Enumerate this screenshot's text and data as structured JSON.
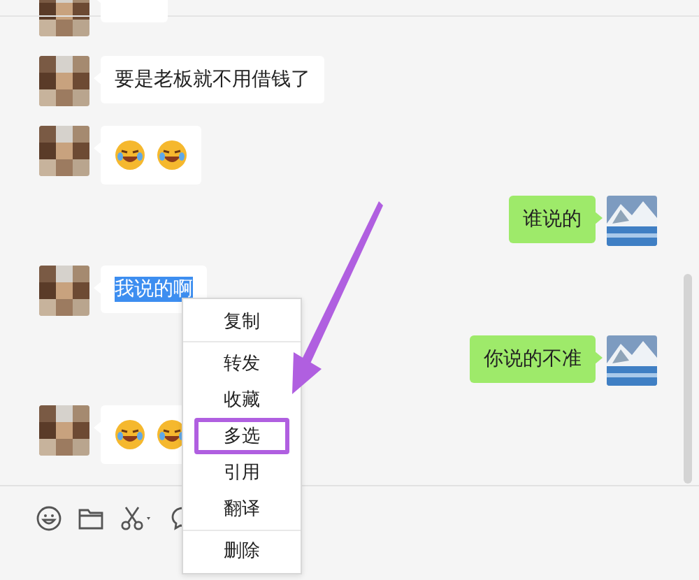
{
  "messages": [
    {
      "kind": "incoming_partial"
    },
    {
      "kind": "incoming_text",
      "text": "要是老板就不用借钱了"
    },
    {
      "kind": "incoming_emoji",
      "emojis": [
        {
          "kind": "laugh"
        },
        {
          "kind": "laugh"
        }
      ]
    },
    {
      "kind": "outgoing_text",
      "text": "谁说的"
    },
    {
      "kind": "incoming_text",
      "text": "我说的啊",
      "text_selected": true
    },
    {
      "kind": "outgoing_text",
      "text": "你说的不准"
    },
    {
      "kind": "incoming_emoji",
      "emojis": [
        {
          "kind": "laugh"
        },
        {
          "kind": "laugh"
        }
      ]
    }
  ],
  "context_menu": {
    "groups": [
      {
        "items": [
          {
            "label": "复制",
            "highlighted": false
          }
        ]
      },
      {
        "items": [
          {
            "label": "转发",
            "highlighted": false
          },
          {
            "label": "收藏",
            "highlighted": false
          },
          {
            "label": "多选",
            "highlighted": true
          },
          {
            "label": "引用",
            "highlighted": false
          },
          {
            "label": "翻译",
            "highlighted": false
          }
        ]
      },
      {
        "items": [
          {
            "label": "删除",
            "highlighted": false
          }
        ]
      }
    ]
  },
  "toolbar": [
    {
      "kind": "emoji"
    },
    {
      "kind": "folder"
    },
    {
      "kind": "scissors"
    },
    {
      "kind": "chat"
    }
  ]
}
